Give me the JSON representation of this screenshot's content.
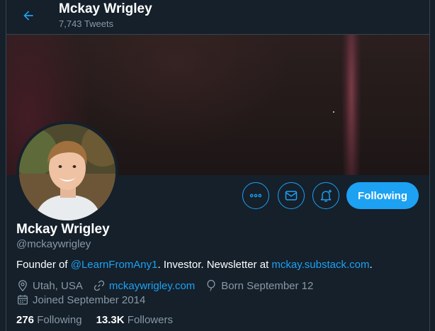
{
  "header": {
    "back_icon": "arrow-left-icon",
    "name": "Mckay Wrigley",
    "tweet_count": "7,743 Tweets"
  },
  "profile": {
    "name": "Mckay Wrigley",
    "handle": "@mckaywrigley",
    "bio_prefix": "Founder of ",
    "bio_mention": "@LearnFromAny1",
    "bio_middle": ". Investor. Newsletter at ",
    "bio_link": "mckay.substack.com",
    "bio_suffix": ".",
    "location": "Utah, USA",
    "website": "mckaywrigley.com",
    "birthday": "Born September 12",
    "joined": "Joined September 2014"
  },
  "actions": {
    "more_icon": "more-icon",
    "message_icon": "mail-icon",
    "notify_icon": "bell-plus-icon",
    "follow_label": "Following"
  },
  "stats": {
    "following_count": "276",
    "following_label": "Following",
    "followers_count": "13.3K",
    "followers_label": "Followers"
  },
  "colors": {
    "background": "#15202b",
    "accent": "#1da1f2",
    "secondary_text": "#8899a6",
    "border": "#38444d"
  }
}
